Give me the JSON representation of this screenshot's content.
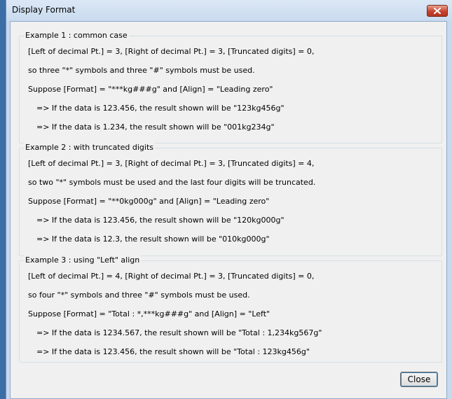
{
  "window": {
    "title": "Display Format"
  },
  "examples": [
    {
      "label": "Example 1 : common case",
      "lines": [
        "[Left of decimal Pt.] = 3, [Right of decimal Pt.] = 3, [Truncated digits] = 0,",
        "so three \"*\" symbols and three \"#\" symbols must be used.",
        "Suppose [Format] = \"***kg###g\" and [Align] = \"Leading zero\"",
        "=> If the data is 123.456, the result shown will be \"123kg456g\"",
        "=> If the data is 1.234, the result shown will be \"001kg234g\""
      ]
    },
    {
      "label": "Example 2 : with truncated digits",
      "lines": [
        "[Left of decimal Pt.] = 3, [Right of decimal Pt.] = 3, [Truncated digits] = 4,",
        "so two \"*\" symbols must be used and the last four digits will be truncated.",
        "Suppose [Format] = \"**0kg000g\" and [Align] = \"Leading zero\"",
        "=> If the data is 123.456, the result shown will be \"120kg000g\"",
        "=> If the data is 12.3, the result shown will be \"010kg000g\""
      ]
    },
    {
      "label": "Example 3 : using \"Left\" align",
      "lines": [
        "[Left of decimal Pt.] = 4, [Right of decimal Pt.] = 3, [Truncated digits] = 0,",
        "so four \"*\" symbols and three \"#\" symbols must be used.",
        "Suppose [Format] = \"Total : *,***kg###g\" and [Align] = \"Left\"",
        "=> If the data is 1234.567, the result shown will be \"Total : 1,234kg567g\"",
        "=> If the data is 123.456, the result shown will be \"Total : 123kg456g\""
      ]
    }
  ],
  "buttons": {
    "close_label": "Close"
  }
}
